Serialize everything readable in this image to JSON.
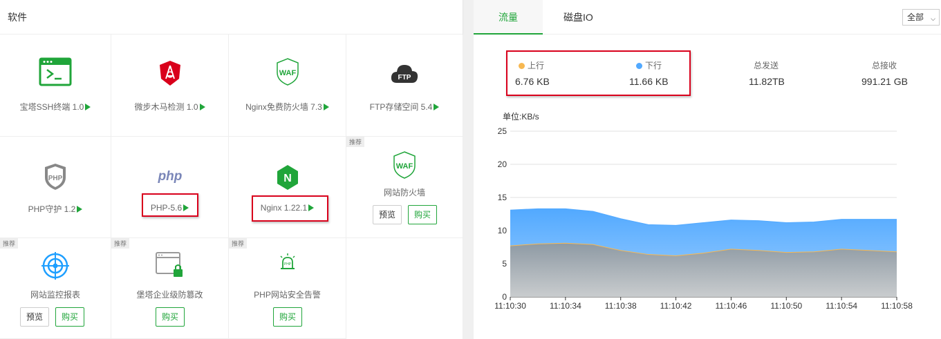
{
  "software": {
    "title": "软件",
    "items": [
      {
        "label": "宝塔SSH终端 1.0",
        "icon": "terminal-icon"
      },
      {
        "label": "微步木马检测 1.0",
        "icon": "shield-icon"
      },
      {
        "label": "Nginx免费防火墙 7.3",
        "icon": "waf-icon",
        "icon_text": "WAF"
      },
      {
        "label": "FTP存储空间 5.4",
        "icon": "ftp-cloud-icon",
        "icon_text": "FTP"
      },
      {
        "label": "PHP守护 1.2",
        "icon": "php-shield-icon",
        "icon_text": "PHP"
      },
      {
        "label": "PHP-5.6",
        "icon": "php-icon",
        "icon_text": "php"
      },
      {
        "label": "Nginx 1.22.1",
        "icon": "nginx-icon",
        "icon_text": "N"
      },
      {
        "label": "网站防火墙",
        "icon": "waf-icon",
        "icon_text": "WAF",
        "tag": "推荐",
        "preview": "预览",
        "buy": "购买"
      },
      {
        "label": "网站监控报表",
        "icon": "monitor-target-icon",
        "tag": "推荐",
        "preview": "预览",
        "buy": "购买"
      },
      {
        "label": "堡塔企业级防篡改",
        "icon": "window-lock-icon",
        "tag": "推荐",
        "buy": "购买"
      },
      {
        "label": "PHP网站安全告警",
        "icon": "alarm-icon",
        "icon_text": "PHP",
        "tag": "推荐",
        "buy": "购买"
      }
    ]
  },
  "traffic": {
    "tabs": [
      "流量",
      "磁盘IO"
    ],
    "select": "全部",
    "up_label": "上行",
    "up_value": "6.76 KB",
    "down_label": "下行",
    "down_value": "11.66 KB",
    "sent_label": "总发送",
    "sent_value": "11.82TB",
    "recv_label": "总接收",
    "recv_value": "991.21 GB",
    "unit_label": "单位:KB/s",
    "colors": {
      "up": "#f7b851",
      "down": "#52a9ff",
      "accent": "#20a53a"
    }
  },
  "chart_data": {
    "type": "area",
    "x": [
      "11:10:30",
      "11:10:32",
      "11:10:34",
      "11:10:36",
      "11:10:38",
      "11:10:40",
      "11:10:42",
      "11:10:44",
      "11:10:46",
      "11:10:48",
      "11:10:50",
      "11:10:52",
      "11:10:54",
      "11:10:56",
      "11:10:58"
    ],
    "xticks": [
      "11:10:30",
      "11:10:34",
      "11:10:38",
      "11:10:42",
      "11:10:46",
      "11:10:50",
      "11:10:54",
      "11:10:58"
    ],
    "ylim": [
      0,
      25
    ],
    "yticks": [
      0,
      5,
      10,
      15,
      20,
      25
    ],
    "series": [
      {
        "name": "上行",
        "values": [
          7.7,
          8.0,
          8.1,
          7.9,
          7.0,
          6.4,
          6.2,
          6.6,
          7.2,
          7.0,
          6.7,
          6.8,
          7.2,
          7.0,
          6.8
        ]
      },
      {
        "name": "下行",
        "values": [
          13.1,
          13.3,
          13.3,
          12.9,
          11.8,
          10.9,
          10.8,
          11.2,
          11.6,
          11.5,
          11.2,
          11.3,
          11.7,
          11.7,
          11.7
        ]
      }
    ]
  }
}
